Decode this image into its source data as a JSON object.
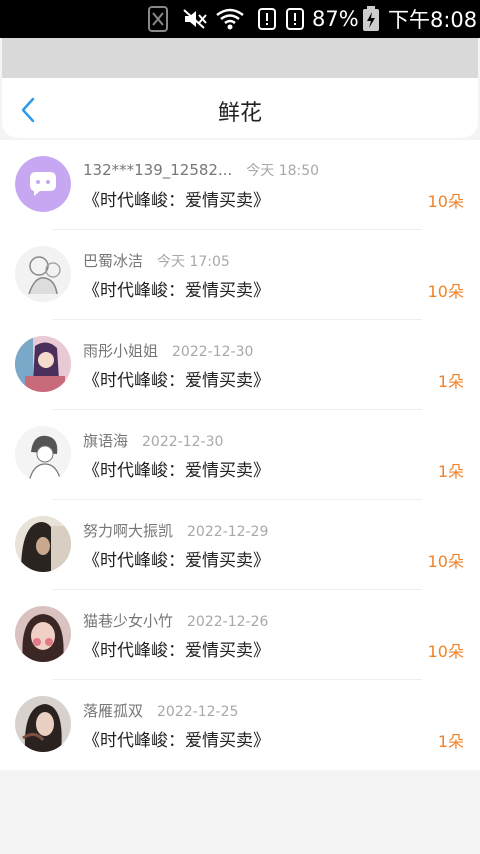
{
  "status_bar": {
    "battery_percent": "87%",
    "time": "下午8:08",
    "icons": [
      "app-notification-icon",
      "mute-icon",
      "wifi-icon",
      "alert-icon",
      "alert-icon",
      "battery-icon"
    ]
  },
  "header": {
    "title": "鲜花",
    "back_icon": "chevron-left-icon"
  },
  "colors": {
    "accent_blue": "#2f9be8",
    "count_orange": "#f0832a"
  },
  "gifts": [
    {
      "user": "132***139_12582...",
      "time": "今天 18:50",
      "book": "《时代峰峻：爱情买卖》",
      "count": "10朵",
      "avatar": "chat-bubble-avatar-icon"
    },
    {
      "user": "巴蜀冰洁",
      "time": "今天 17:05",
      "book": "《时代峰峻：爱情买卖》",
      "count": "10朵",
      "avatar": "user-avatar"
    },
    {
      "user": "雨彤小姐姐",
      "time": "2022-12-30",
      "book": "《时代峰峻：爱情买卖》",
      "count": "1朵",
      "avatar": "user-avatar"
    },
    {
      "user": "旗语海",
      "time": "2022-12-30",
      "book": "《时代峰峻：爱情买卖》",
      "count": "1朵",
      "avatar": "user-avatar"
    },
    {
      "user": "努力啊大振凯",
      "time": "2022-12-29",
      "book": "《时代峰峻：爱情买卖》",
      "count": "10朵",
      "avatar": "user-avatar"
    },
    {
      "user": "猫巷少女小竹",
      "time": "2022-12-26",
      "book": "《时代峰峻：爱情买卖》",
      "count": "10朵",
      "avatar": "user-avatar"
    },
    {
      "user": "落雁孤双",
      "time": "2022-12-25",
      "book": "《时代峰峻：爱情买卖》",
      "count": "1朵",
      "avatar": "user-avatar"
    }
  ]
}
